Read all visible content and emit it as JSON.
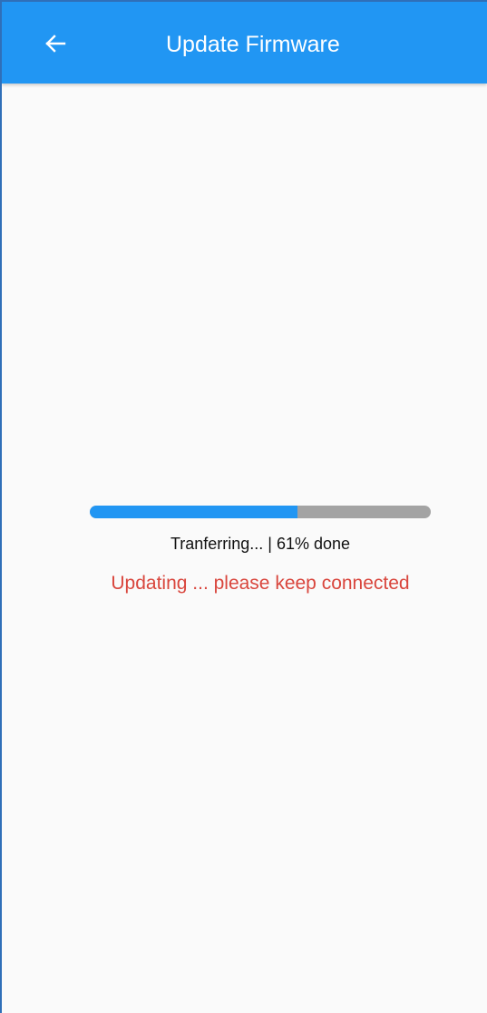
{
  "app_bar": {
    "title": "Update Firmware",
    "back_icon": "arrow-left-icon",
    "background_color": "#2196f3"
  },
  "update": {
    "progress_percent": 61,
    "progress_label": "Tranferring... | 61% done",
    "status_message": "Updating ... please keep connected",
    "progress_color": "#2196f3",
    "track_color": "#a3a3a3",
    "status_color": "#d9463d"
  }
}
